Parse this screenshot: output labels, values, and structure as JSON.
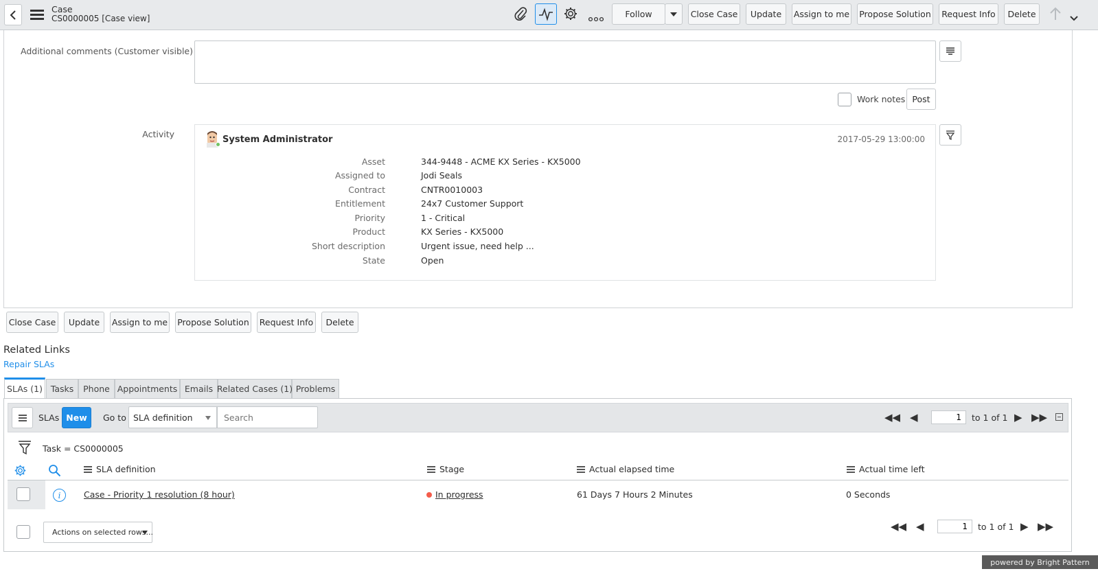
{
  "header": {
    "title": "Case",
    "subtitle": "CS0000005 [Case view]",
    "follow_label": "Follow",
    "buttons": [
      "Close Case",
      "Update",
      "Assign to me",
      "Propose Solution",
      "Request Info",
      "Delete"
    ]
  },
  "comments": {
    "label": "Additional comments (Customer visible)",
    "value": "",
    "work_notes_label": "Work notes",
    "post_label": "Post"
  },
  "activity": {
    "label": "Activity",
    "user": "System Administrator",
    "timestamp": "2017-05-29 13:00:00",
    "fields": [
      {
        "label": "Asset",
        "value": "344-9448 - ACME KX Series - KX5000"
      },
      {
        "label": "Assigned to",
        "value": "Jodi Seals"
      },
      {
        "label": "Contract",
        "value": "CNTR0010003"
      },
      {
        "label": "Entitlement",
        "value": "24x7 Customer Support"
      },
      {
        "label": "Priority",
        "value": "1 - Critical"
      },
      {
        "label": "Product",
        "value": "KX Series - KX5000"
      },
      {
        "label": "Short description",
        "value": "Urgent issue, need help ..."
      },
      {
        "label": "State",
        "value": "Open"
      }
    ]
  },
  "form_buttons": [
    "Close Case",
    "Update",
    "Assign to me",
    "Propose Solution",
    "Request Info",
    "Delete"
  ],
  "related_links": {
    "heading": "Related Links",
    "links": [
      "Repair SLAs"
    ]
  },
  "tabs": [
    "SLAs (1)",
    "Tasks",
    "Phone",
    "Appointments",
    "Emails",
    "Related Cases (1)",
    "Problems"
  ],
  "list": {
    "title": "SLAs",
    "new_label": "New",
    "goto_label": "Go to",
    "goto_select": "SLA definition",
    "search_placeholder": "Search",
    "page_value": "1",
    "page_text": "to 1 of 1",
    "filter_text": "Task = CS0000005",
    "columns": [
      "SLA definition",
      "Stage",
      "Actual elapsed time",
      "Actual time left"
    ],
    "rows": [
      {
        "sla_definition": "Case - Priority 1 resolution (8 hour)",
        "stage": "In progress",
        "elapsed": "61 Days 7 Hours 2 Minutes",
        "time_left": "0 Seconds"
      }
    ],
    "actions_label": "Actions on selected rows..."
  },
  "footer": {
    "powered_by": "powered by Bright Pattern"
  },
  "colors": {
    "accent": "#1f8ee9",
    "status_in_progress": "#f45c4b",
    "header_bg": "#e8eaec"
  }
}
